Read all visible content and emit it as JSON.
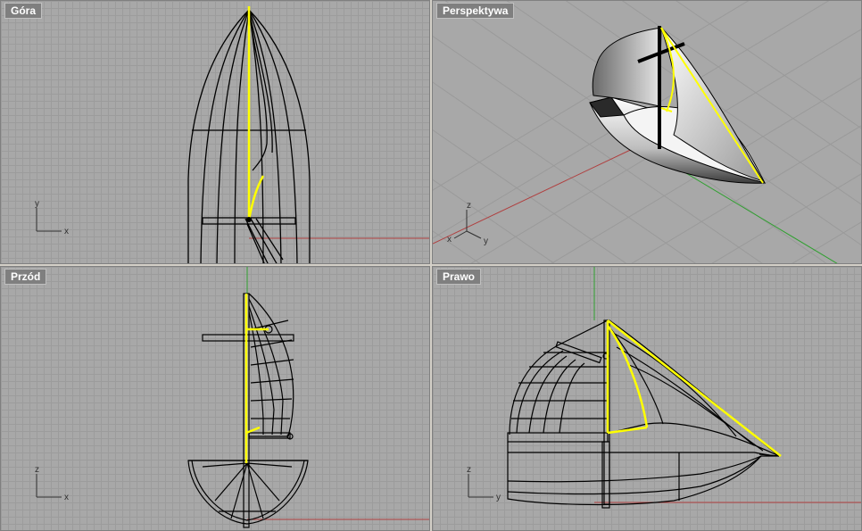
{
  "viewports": {
    "top": {
      "label": "Góra"
    },
    "persp": {
      "label": "Perspektywa"
    },
    "front": {
      "label": "Przód"
    },
    "right": {
      "label": "Prawo"
    }
  },
  "axes": {
    "top": {
      "v": "y",
      "h": "x"
    },
    "persp": {
      "v": "z",
      "h1": "x",
      "h2": "y"
    },
    "front": {
      "v": "z",
      "h": "x"
    },
    "right": {
      "v": "z",
      "h": "y"
    }
  },
  "colors": {
    "grid_bg": "#a8a8a8",
    "x_axis": "#b04040",
    "y_axis": "#30a030",
    "selection": "#ffff00",
    "wire": "#000000"
  }
}
